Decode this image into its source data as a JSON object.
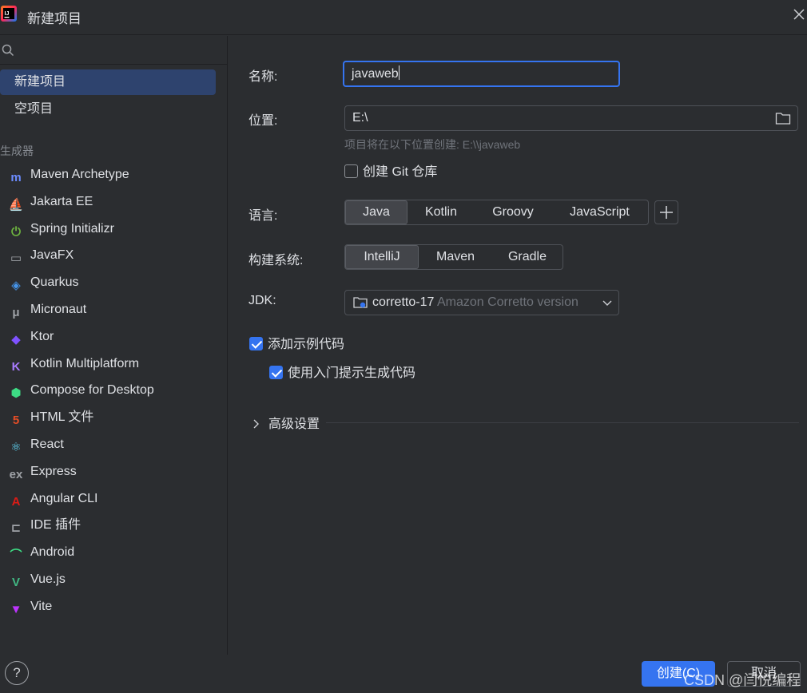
{
  "window": {
    "title": "新建项目",
    "close_icon": "close-icon"
  },
  "sidebar": {
    "nav": [
      {
        "label": "新建项目",
        "selected": true
      },
      {
        "label": "空项目",
        "selected": false
      }
    ],
    "group_label": "生成器",
    "generators": [
      {
        "label": "Maven Archetype",
        "icon": "maven-icon",
        "glyph": "m",
        "color": "#6c8cff"
      },
      {
        "label": "Jakarta EE",
        "icon": "jakarta-icon",
        "glyph": "⛵",
        "color": "#f0a732"
      },
      {
        "label": "Spring Initializr",
        "icon": "spring-icon",
        "glyph": "⏻",
        "color": "#6db33f"
      },
      {
        "label": "JavaFX",
        "icon": "javafx-icon",
        "glyph": "▭",
        "color": "#a0a3a8"
      },
      {
        "label": "Quarkus",
        "icon": "quarkus-icon",
        "glyph": "◈",
        "color": "#4695eb"
      },
      {
        "label": "Micronaut",
        "icon": "micronaut-icon",
        "glyph": "μ",
        "color": "#a0a3a8"
      },
      {
        "label": "Ktor",
        "icon": "ktor-icon",
        "glyph": "◆",
        "color": "#7f52ff"
      },
      {
        "label": "Kotlin Multiplatform",
        "icon": "kotlin-icon",
        "glyph": "K",
        "color": "#a97bff"
      },
      {
        "label": "Compose for Desktop",
        "icon": "compose-icon",
        "glyph": "⬢",
        "color": "#3ddc84"
      },
      {
        "label": "HTML 文件",
        "icon": "html-icon",
        "glyph": "5",
        "color": "#e44d26"
      },
      {
        "label": "React",
        "icon": "react-icon",
        "glyph": "⚛",
        "color": "#61dafb"
      },
      {
        "label": "Express",
        "icon": "express-icon",
        "glyph": "ex",
        "color": "#a0a3a8"
      },
      {
        "label": "Angular CLI",
        "icon": "angular-icon",
        "glyph": "A",
        "color": "#dd1b16"
      },
      {
        "label": "IDE 插件",
        "icon": "plugin-icon",
        "glyph": "⊏",
        "color": "#a0a3a8"
      },
      {
        "label": "Android",
        "icon": "android-icon",
        "glyph": "⌒",
        "color": "#3ddc84"
      },
      {
        "label": "Vue.js",
        "icon": "vue-icon",
        "glyph": "V",
        "color": "#41b883"
      },
      {
        "label": "Vite",
        "icon": "vite-icon",
        "glyph": "▼",
        "color": "#bd34fe"
      }
    ]
  },
  "form": {
    "name_label": "名称:",
    "name_value": "javaweb",
    "location_label": "位置:",
    "location_value": "E:\\",
    "location_hint": "项目将在以下位置创建: E:\\\\javaweb",
    "git_label": "创建 Git 仓库",
    "git_checked": false,
    "language_label": "语言:",
    "languages": [
      {
        "label": "Java",
        "active": true
      },
      {
        "label": "Kotlin",
        "active": false
      },
      {
        "label": "Groovy",
        "active": false
      },
      {
        "label": "JavaScript",
        "active": false
      }
    ],
    "build_label": "构建系统:",
    "build_systems": [
      {
        "label": "IntelliJ",
        "active": true
      },
      {
        "label": "Maven",
        "active": false
      },
      {
        "label": "Gradle",
        "active": false
      }
    ],
    "jdk_label": "JDK:",
    "jdk_name": "corretto-17",
    "jdk_vendor": "Amazon Corretto version",
    "sample_label": "添加示例代码",
    "sample_checked": true,
    "onboarding_label": "使用入门提示生成代码",
    "onboarding_checked": true,
    "advanced_label": "高级设置"
  },
  "footer": {
    "help_label": "?",
    "create_label": "创建(C)",
    "cancel_label": "取消",
    "watermark": "CSDN @闫悦编程"
  },
  "colors": {
    "accent": "#3574f0",
    "background": "#2b2d30",
    "selected_nav": "#2e436e"
  }
}
